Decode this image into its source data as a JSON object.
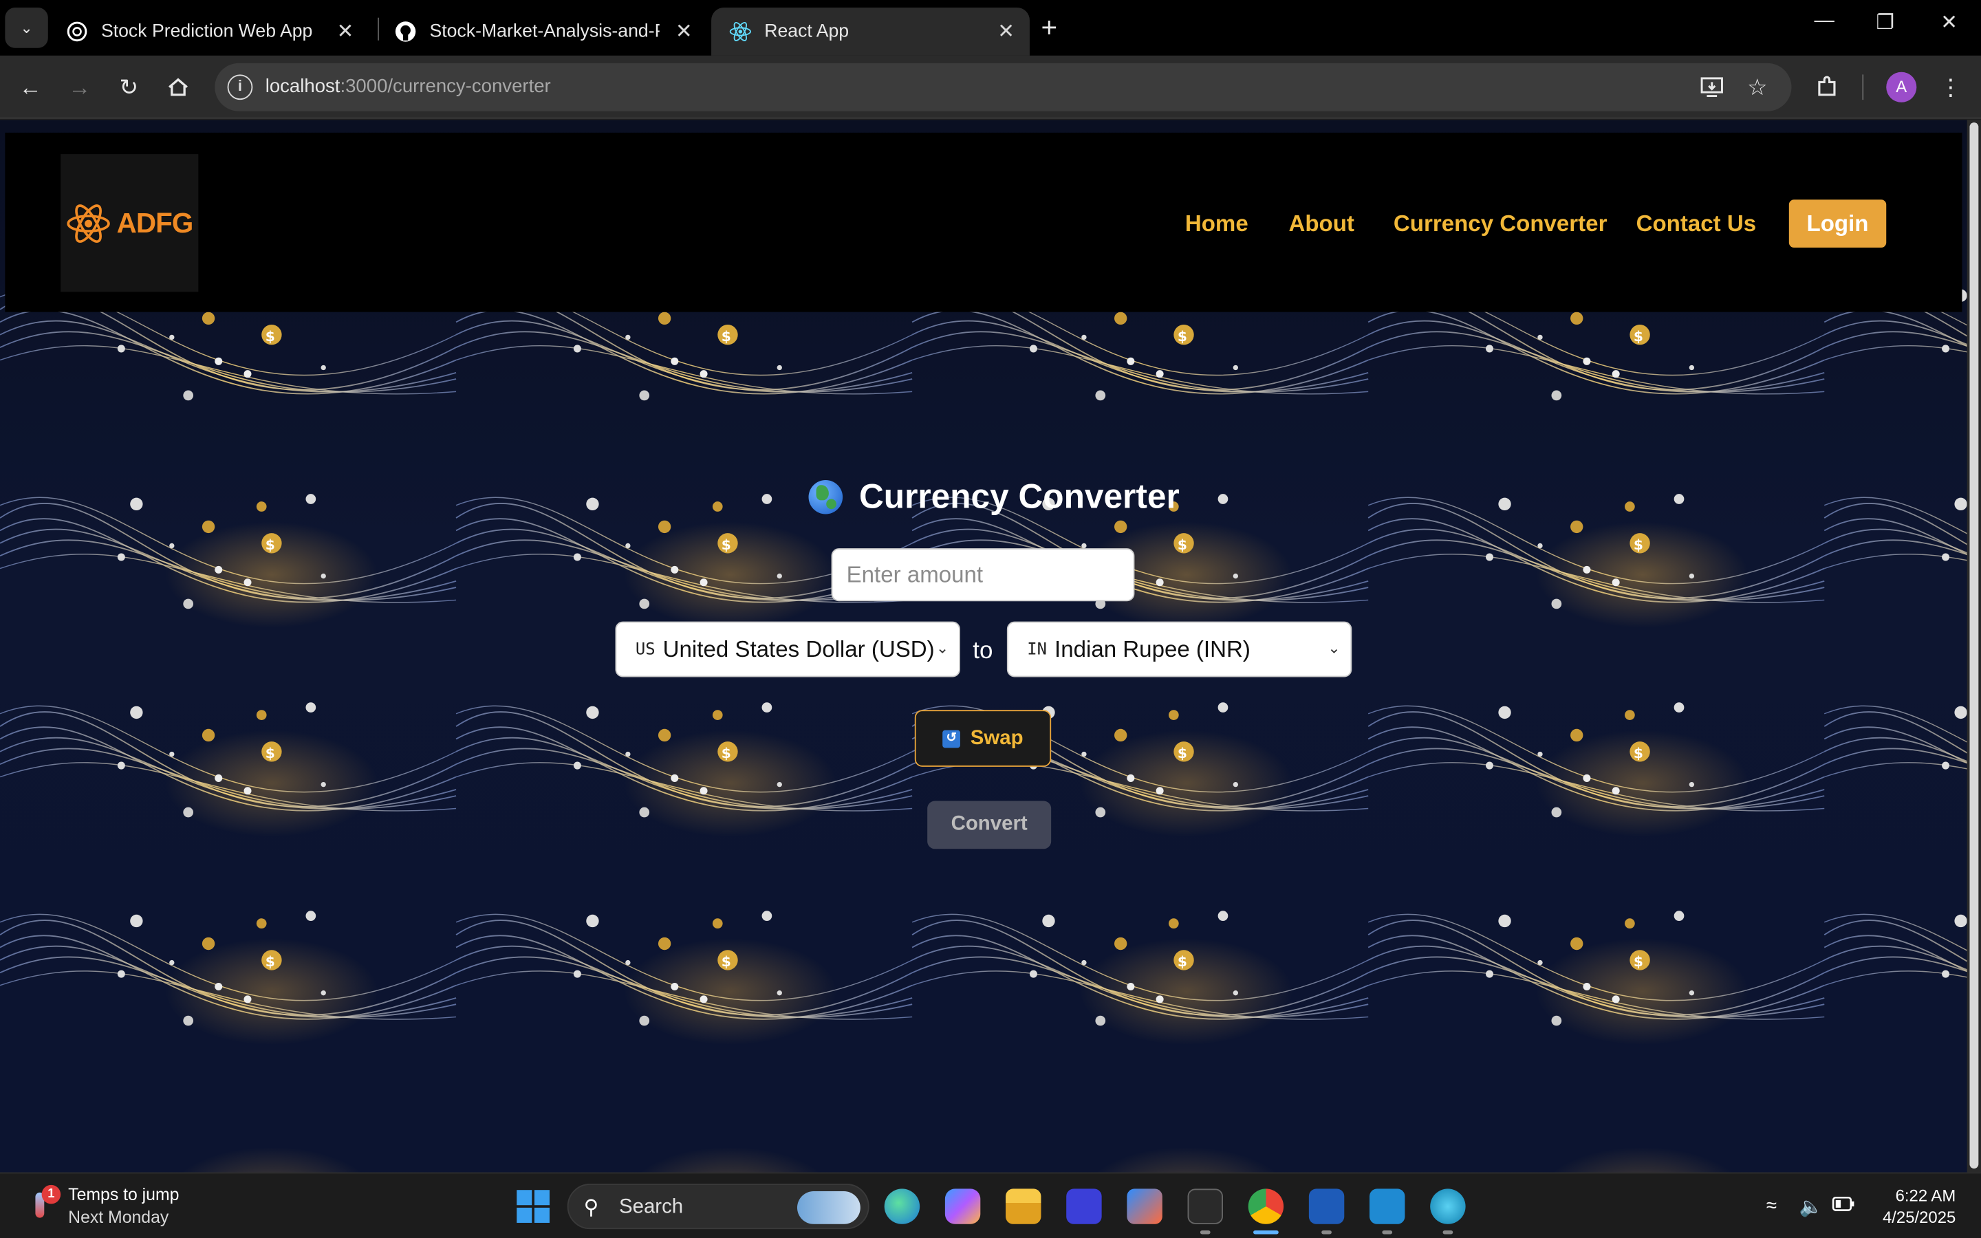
{
  "browser": {
    "tabs": [
      {
        "title": "Stock Prediction Web App",
        "favicon": "openai-icon"
      },
      {
        "title": "Stock-Market-Analysis-and-Pre",
        "favicon": "github-icon"
      },
      {
        "title": "React App",
        "favicon": "react-icon",
        "active": true
      }
    ],
    "url_host": "localhost",
    "url_path": ":3000/currency-converter",
    "profile_initial": "A"
  },
  "site": {
    "logo_text": "ADFG",
    "nav": [
      "Home",
      "About",
      "Currency Converter",
      "Contact Us"
    ],
    "login_label": "Login",
    "accent_color": "#e8a43a",
    "link_color": "#f2b838"
  },
  "converter": {
    "title": "Currency Converter",
    "amount_placeholder": "Enter amount",
    "from": {
      "code": "US",
      "label": "United States Dollar (USD)"
    },
    "to_label": "to",
    "to": {
      "code": "IN",
      "label": "Indian Rupee (INR)"
    },
    "swap_label": "Swap",
    "convert_label": "Convert"
  },
  "taskbar": {
    "weather_title": "Temps to jump",
    "weather_sub": "Next Monday",
    "weather_badge": "1",
    "search_label": "Search",
    "time": "6:22 AM",
    "date": "4/25/2025"
  }
}
